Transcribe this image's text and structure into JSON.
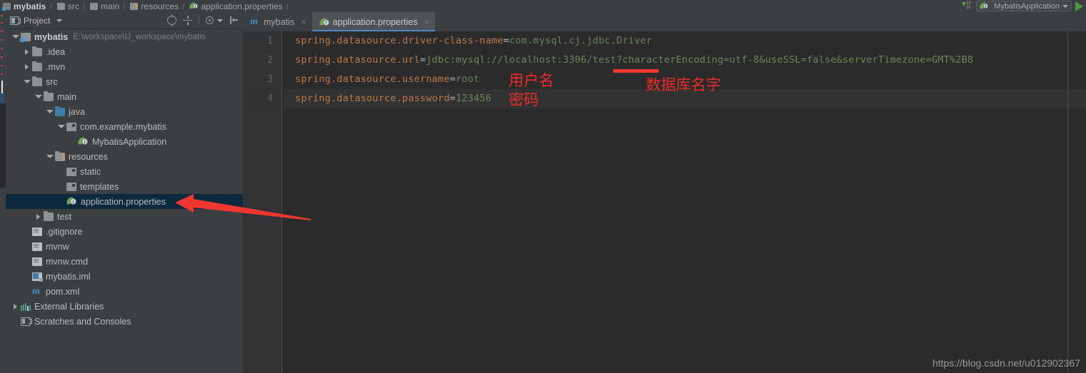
{
  "breadcrumb": {
    "items": [
      {
        "label": "mybatis",
        "icon": "module-icon"
      },
      {
        "label": "src",
        "icon": "folder-icon"
      },
      {
        "label": "main",
        "icon": "folder-icon"
      },
      {
        "label": "resources",
        "icon": "resources-folder-icon"
      },
      {
        "label": "application.properties",
        "icon": "spring-properties-icon"
      }
    ],
    "separator": "/"
  },
  "toolbar": {
    "download_icon": "download-icon",
    "download_digits": "10\n01",
    "run_config": {
      "name": "MybatisApplication",
      "icon": "spring-boot-icon",
      "dropdown_icon": "chevron-down-icon"
    },
    "run_button_icon": "run-play-icon"
  },
  "project_panel": {
    "title": "Project",
    "dropdown_icon": "chevron-down-icon",
    "actions": [
      {
        "name": "scroll-from-source-icon",
        "label": "Select Opened File"
      },
      {
        "name": "collapse-all-icon",
        "label": "Collapse All"
      },
      {
        "name": "settings-gear-icon",
        "label": "Settings"
      },
      {
        "name": "hide-panel-icon",
        "label": "Hide"
      }
    ],
    "tree": [
      {
        "label": "mybatis",
        "path": "E:\\workspace\\IJ_workspace\\mybatis",
        "indent": 0,
        "arrow": "down",
        "icon": "module-icon",
        "bold": true,
        "selected": false
      },
      {
        "label": ".idea",
        "path": "",
        "indent": 1,
        "arrow": "right",
        "icon": "folder-icon",
        "bold": false,
        "selected": false
      },
      {
        "label": ".mvn",
        "path": "",
        "indent": 1,
        "arrow": "right",
        "icon": "folder-icon",
        "bold": false,
        "selected": false
      },
      {
        "label": "src",
        "path": "",
        "indent": 1,
        "arrow": "down",
        "icon": "folder-icon",
        "bold": false,
        "selected": false
      },
      {
        "label": "main",
        "path": "",
        "indent": 2,
        "arrow": "down",
        "icon": "folder-icon",
        "bold": false,
        "selected": false
      },
      {
        "label": "java",
        "path": "",
        "indent": 3,
        "arrow": "down",
        "icon": "source-folder-icon",
        "bold": false,
        "selected": false
      },
      {
        "label": "com.example.mybatis",
        "path": "",
        "indent": 4,
        "arrow": "down",
        "icon": "package-icon",
        "bold": false,
        "selected": false
      },
      {
        "label": "MybatisApplication",
        "path": "",
        "indent": 5,
        "arrow": "none",
        "icon": "spring-boot-icon",
        "bold": false,
        "selected": false
      },
      {
        "label": "resources",
        "path": "",
        "indent": 3,
        "arrow": "down",
        "icon": "resources-folder-icon",
        "bold": false,
        "selected": false
      },
      {
        "label": "static",
        "path": "",
        "indent": 4,
        "arrow": "none",
        "icon": "package-icon",
        "bold": false,
        "selected": false
      },
      {
        "label": "templates",
        "path": "",
        "indent": 4,
        "arrow": "none",
        "icon": "package-icon",
        "bold": false,
        "selected": false
      },
      {
        "label": "application.properties",
        "path": "",
        "indent": 4,
        "arrow": "none",
        "icon": "spring-properties-icon",
        "bold": false,
        "selected": true
      },
      {
        "label": "test",
        "path": "",
        "indent": 2,
        "arrow": "right",
        "icon": "folder-icon",
        "bold": false,
        "selected": false
      },
      {
        "label": ".gitignore",
        "path": "",
        "indent": 1,
        "arrow": "none",
        "icon": "file-icon",
        "bold": false,
        "selected": false
      },
      {
        "label": "mvnw",
        "path": "",
        "indent": 1,
        "arrow": "none",
        "icon": "file-icon",
        "bold": false,
        "selected": false
      },
      {
        "label": "mvnw.cmd",
        "path": "",
        "indent": 1,
        "arrow": "none",
        "icon": "file-icon",
        "bold": false,
        "selected": false
      },
      {
        "label": "mybatis.iml",
        "path": "",
        "indent": 1,
        "arrow": "none",
        "icon": "iml-file-icon",
        "bold": false,
        "selected": false
      },
      {
        "label": "pom.xml",
        "path": "",
        "indent": 1,
        "arrow": "none",
        "icon": "maven-pom-icon",
        "bold": false,
        "selected": false
      },
      {
        "label": "External Libraries",
        "path": "",
        "indent": 0,
        "arrow": "right",
        "icon": "libraries-icon",
        "bold": false,
        "selected": false
      },
      {
        "label": "Scratches and Consoles",
        "path": "",
        "indent": 0,
        "arrow": "none",
        "icon": "scratches-icon",
        "bold": false,
        "selected": false
      }
    ]
  },
  "editor": {
    "tabs": [
      {
        "label": "mybatis",
        "icon": "maven-pom-icon",
        "active": false,
        "close_icon": "close-icon"
      },
      {
        "label": "application.properties",
        "icon": "spring-properties-icon",
        "active": true,
        "close_icon": "close-icon"
      }
    ],
    "lines": [
      {
        "number": "1",
        "key": "spring.datasource.driver-class-name",
        "eq": "=",
        "value": "com.mysql.cj.jdbc.Driver",
        "current": false
      },
      {
        "number": "2",
        "key": "spring.datasource.url",
        "eq": "=",
        "value": "jdbc:mysql://localhost:3306/test?characterEncoding=utf-8&useSSL=false&serverTimezone=GMT%2B8",
        "current": false
      },
      {
        "number": "3",
        "key": "spring.datasource.username",
        "eq": "=",
        "value": "root",
        "current": false
      },
      {
        "number": "4",
        "key": "spring.datasource.password",
        "eq": "=",
        "value": "123456",
        "current": true
      }
    ]
  },
  "annotations": {
    "username_label": "用户名",
    "password_label": "密码",
    "database_label": "数据库名字",
    "red_color": "#ee2b2b",
    "arrow_color": "#f0372f"
  },
  "watermark": "https://blog.csdn.net/u012902367"
}
